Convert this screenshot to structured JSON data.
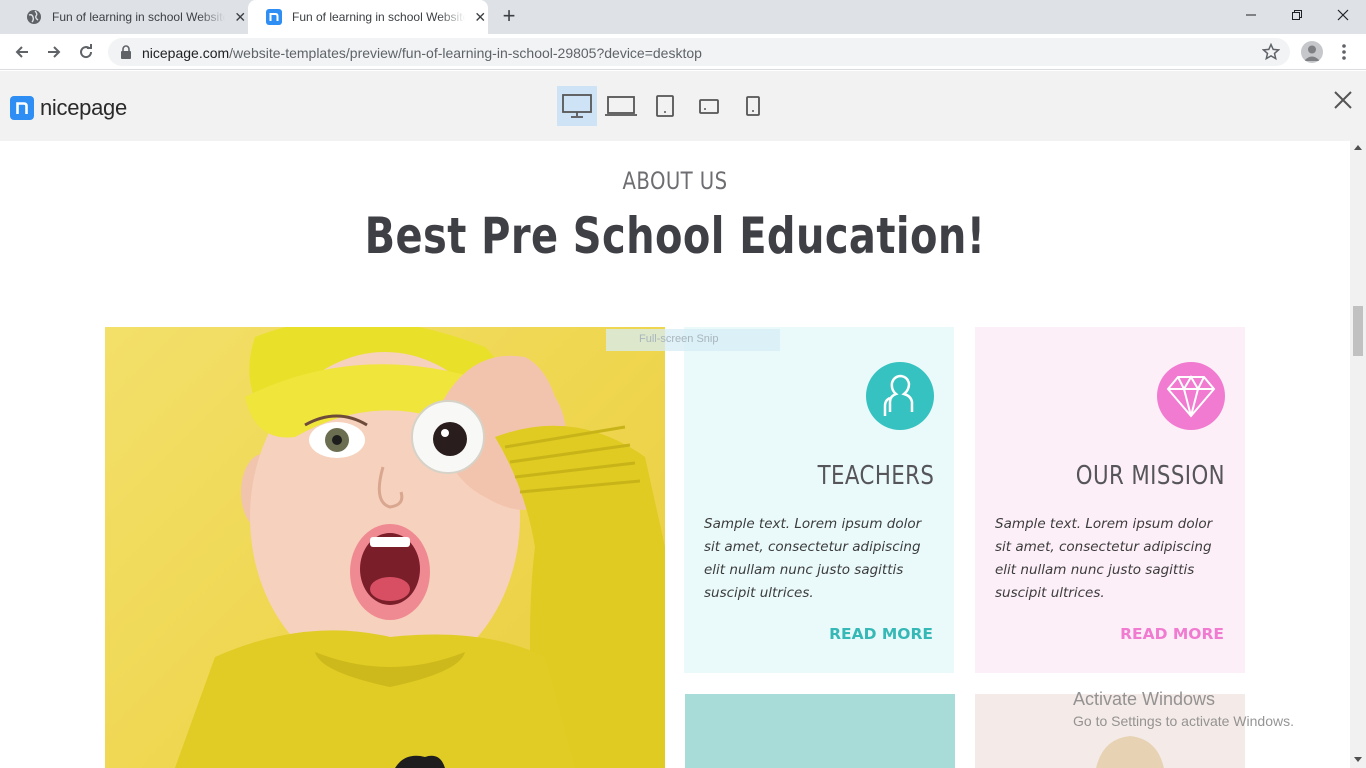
{
  "browser": {
    "tabs": [
      {
        "title": "Fun of learning in school Website Template",
        "active": false
      },
      {
        "title": "Fun of learning in school Website Template",
        "active": true
      }
    ],
    "url": {
      "host": "nicepage.com",
      "path": "/website-templates/preview/fun-of-learning-in-school-29805?device=desktop"
    }
  },
  "preview_header": {
    "logo_text": "nicepage",
    "devices": [
      "desktop-icon",
      "laptop-icon",
      "tablet-icon",
      "tablet-landscape-icon",
      "phone-icon"
    ],
    "selected_device": "desktop"
  },
  "page": {
    "eyebrow": "ABOUT US",
    "headline": "Best Pre School Education!",
    "cards": [
      {
        "title": "TEACHERS",
        "text": "Sample text. Lorem ipsum dolor sit amet, consectetur adipiscing elit nullam nunc justo sagittis suscipit ultrices.",
        "link": "READ MORE",
        "accent": "#36c2c0",
        "icon": "users-icon"
      },
      {
        "title": "OUR MISSION",
        "text": "Sample text. Lorem ipsum dolor sit amet, consectetur adipiscing elit nullam nunc justo sagittis suscipit ultrices.",
        "link": "READ MORE",
        "accent": "#f07bd0",
        "icon": "diamond-icon"
      }
    ]
  },
  "overlays": {
    "snip_tooltip": "Full-screen Snip",
    "activate_title": "Activate Windows",
    "activate_sub": "Go to Settings to activate Windows."
  }
}
